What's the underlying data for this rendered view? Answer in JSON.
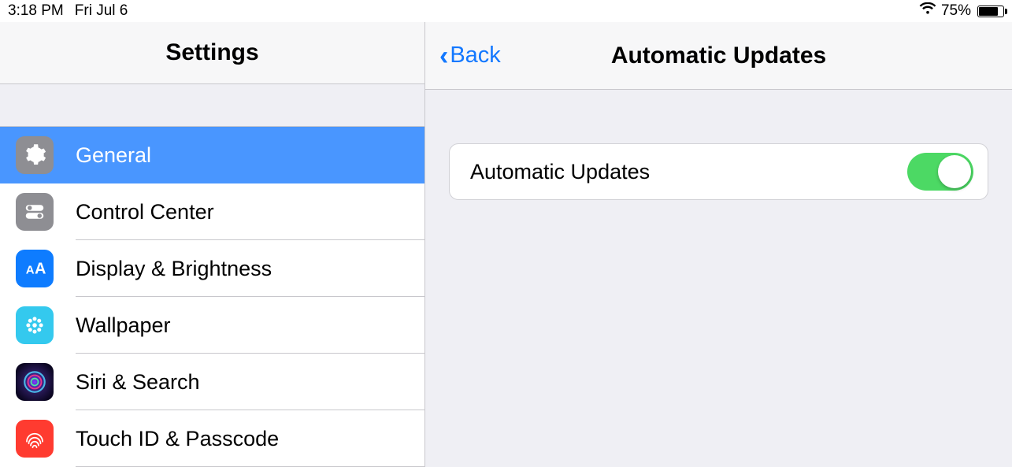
{
  "status": {
    "time": "3:18 PM",
    "date": "Fri Jul 6",
    "battery_percent": "75%"
  },
  "sidebar": {
    "title": "Settings",
    "items": [
      {
        "label": "General"
      },
      {
        "label": "Control Center"
      },
      {
        "label": "Display & Brightness"
      },
      {
        "label": "Wallpaper"
      },
      {
        "label": "Siri & Search"
      },
      {
        "label": "Touch ID & Passcode"
      }
    ]
  },
  "detail": {
    "back_label": "Back",
    "title": "Automatic Updates",
    "row_label": "Automatic Updates",
    "toggle_on": true
  }
}
